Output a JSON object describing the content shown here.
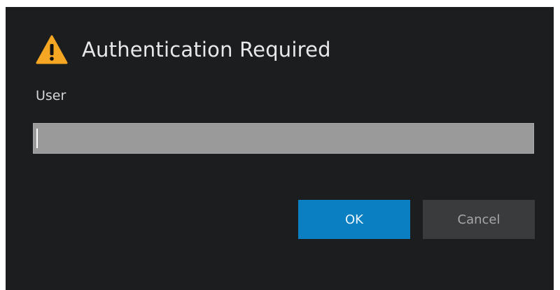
{
  "dialog": {
    "title": "Authentication Required",
    "icon": "warning-icon",
    "field_label": "User",
    "user_value": "",
    "ok_label": "OK",
    "cancel_label": "Cancel"
  },
  "colors": {
    "background": "#1c1d1f",
    "accent": "#0a7fc2",
    "warning": "#f5a623",
    "input_bg": "#9a9a9a",
    "cancel_bg": "#3a3b3d"
  }
}
